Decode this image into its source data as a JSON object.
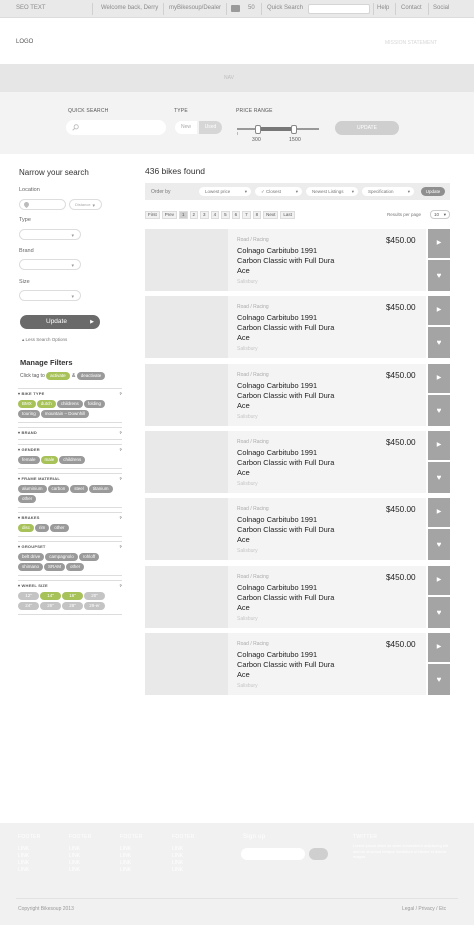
{
  "topbar": {
    "tagline": "SEO TEXT",
    "welcome": "Welcome back, Derry",
    "dealer": "myBikesoup/Dealer",
    "cart_count": "50",
    "quick_search": "Quick Search",
    "help": "Help",
    "contact": "Contact",
    "social": "Social"
  },
  "header": {
    "logo": "LOGO",
    "mission": "MISSION STATEMENT",
    "nav": "NAV"
  },
  "search": {
    "quick_label": "QUICK SEARCH",
    "type_label": "TYPE",
    "type_new": "New",
    "type_used": "Used",
    "price_label": "PRICE RANGE",
    "price_min": "300",
    "price_max": "1500",
    "price_min_fraction": 0.25,
    "price_max_fraction": 0.69,
    "update": "UPDATE"
  },
  "sidebar": {
    "title": "Narrow your search",
    "location": "Location",
    "distance": "Distance",
    "type": "Type",
    "brand": "Brand",
    "size": "Size",
    "update": "Update",
    "less": "Less Search Options",
    "manage_title": "Manage Filters",
    "click_tag": "Click tag to",
    "activate": "activate",
    "and": "&",
    "deactivate": "deactivate",
    "groups": [
      {
        "name": "BIKE TYPE",
        "tags": [
          {
            "t": "BMX",
            "g": true
          },
          {
            "t": "dutch",
            "g": true
          },
          {
            "t": "childrens",
            "g": false
          },
          {
            "t": "folding",
            "g": false
          },
          {
            "t": "touring",
            "g": false
          },
          {
            "t": "mountain – Downhill",
            "g": false
          }
        ]
      },
      {
        "name": "BRAND",
        "tags": []
      },
      {
        "name": "GENDER",
        "tags": [
          {
            "t": "female",
            "g": false
          },
          {
            "t": "male",
            "g": true
          },
          {
            "t": "childrens",
            "g": false
          }
        ]
      },
      {
        "name": "FRAME MATERIAL",
        "tags": [
          {
            "t": "aluminium",
            "g": false
          },
          {
            "t": "carbon",
            "g": false
          },
          {
            "t": "steel",
            "g": false
          },
          {
            "t": "titanium",
            "g": false
          },
          {
            "t": "other",
            "g": false
          }
        ]
      },
      {
        "name": "BRAKES",
        "tags": [
          {
            "t": "disc",
            "g": true
          },
          {
            "t": "rim",
            "g": false
          },
          {
            "t": "other",
            "g": false
          }
        ]
      },
      {
        "name": "GROUPSET",
        "tags": [
          {
            "t": "belt drive",
            "g": false
          },
          {
            "t": "campagnolo",
            "g": false
          },
          {
            "t": "rohloff",
            "g": false
          },
          {
            "t": "shimano",
            "g": false
          },
          {
            "t": "SRAM",
            "g": false
          },
          {
            "t": "other",
            "g": false
          }
        ]
      },
      {
        "name": "WHEEL SIZE",
        "tags": [
          {
            "t": "12\"",
            "g": false
          },
          {
            "t": "14\"",
            "g": true
          },
          {
            "t": "16\"",
            "g": true
          },
          {
            "t": "20\"",
            "g": false
          },
          {
            "t": "24\"",
            "g": false
          },
          {
            "t": "26\"",
            "g": false
          },
          {
            "t": "28\"",
            "g": false
          },
          {
            "t": "29-er",
            "g": false
          }
        ]
      }
    ]
  },
  "results": {
    "count": "436 bikes found",
    "order_by": "Order by",
    "lowest": "Lowest price",
    "closest": "Closest",
    "newest": "Newest Listings",
    "spec": "Specification",
    "order_update": "Update",
    "pages": [
      "First",
      "Prev",
      "1",
      "2",
      "3",
      "4",
      "5",
      "6",
      "7",
      "8",
      "Next",
      "Last"
    ],
    "active_page": "1",
    "rpp_label": "Results per page",
    "rpp_value": "10",
    "items": [
      {
        "cat": "Road / Racing",
        "title": "Colnago Carbitubo 1991 Carbon Classic with Full Dura Ace",
        "loc": "Salisbury",
        "price": "$450.00"
      },
      {
        "cat": "Road / Racing",
        "title": "Colnago Carbitubo 1991 Carbon Classic with Full Dura Ace",
        "loc": "Salisbury",
        "price": "$450.00"
      },
      {
        "cat": "Road / Racing",
        "title": "Colnago Carbitubo 1991 Carbon Classic with Full Dura Ace",
        "loc": "Salisbury",
        "price": "$450.00"
      },
      {
        "cat": "Road / Racing",
        "title": "Colnago Carbitubo 1991 Carbon Classic with Full Dura Ace",
        "loc": "Salisbury",
        "price": "$450.00"
      },
      {
        "cat": "Road / Racing",
        "title": "Colnago Carbitubo 1991 Carbon Classic with Full Dura Ace",
        "loc": "Salisbury",
        "price": "$450.00"
      },
      {
        "cat": "Road / Racing",
        "title": "Colnago Carbitubo 1991 Carbon Classic with Full Dura Ace",
        "loc": "Salisbury",
        "price": "$450.00"
      },
      {
        "cat": "Road / Racing",
        "title": "Colnago Carbitubo 1991 Carbon Classic with Full Dura Ace",
        "loc": "Salisbury",
        "price": "$450.00"
      }
    ]
  },
  "footer": {
    "cols": [
      {
        "head": "FOOTER",
        "links": [
          "LINK",
          "LINK",
          "LINK",
          "LINK"
        ]
      },
      {
        "head": "FOOTER",
        "links": [
          "LINK",
          "LINK",
          "LINK",
          "LINK"
        ]
      },
      {
        "head": "FOOTER",
        "links": [
          "LINK",
          "LINK",
          "LINK",
          "LINK"
        ]
      },
      {
        "head": "FOOTER",
        "links": [
          "LINK",
          "LINK",
          "LINK",
          "LINK"
        ]
      }
    ],
    "signup": "Sign up",
    "twitter": "TWITTER",
    "twitter_text": "Lorem ipsum dolor sit amet consectetur adipiscing elit sed do eiusmod tempor incididunt ut labore et dolore magna",
    "copyright": "Copyright Bikesoup 2013",
    "legal": "Legal / Privacy / Etc"
  },
  "colors": {
    "accent_green": "#a8c25a",
    "gray": "#a4a4a4"
  }
}
